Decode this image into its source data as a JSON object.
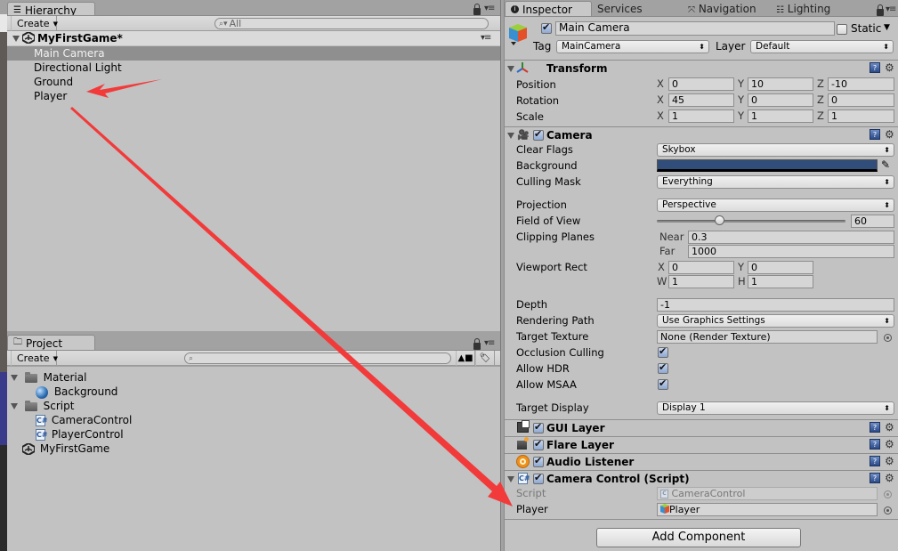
{
  "hierarchy": {
    "tab_label": "Hierarchy",
    "create_label": "Create",
    "search_placeholder": "All",
    "scene_name": "MyFirstGame*",
    "items": [
      {
        "label": "Main Camera",
        "selected": true
      },
      {
        "label": "Directional Light",
        "selected": false
      },
      {
        "label": "Ground",
        "selected": false
      },
      {
        "label": "Player",
        "selected": false
      }
    ]
  },
  "project": {
    "tab_label": "Project",
    "create_label": "Create",
    "search_placeholder": "",
    "tree": [
      {
        "label": "Material",
        "type": "folder",
        "expanded": true
      },
      {
        "label": "Background",
        "type": "material"
      },
      {
        "label": "Script",
        "type": "folder",
        "expanded": true
      },
      {
        "label": "CameraControl",
        "type": "script"
      },
      {
        "label": "PlayerControl",
        "type": "script"
      },
      {
        "label": "MyFirstGame",
        "type": "scene"
      }
    ]
  },
  "inspector": {
    "tabs": [
      "Inspector",
      "Services",
      "Navigation",
      "Lighting"
    ],
    "active_tab": "Inspector",
    "object_name": "Main Camera",
    "object_active": true,
    "static_label": "Static",
    "static_checked": false,
    "tag_label": "Tag",
    "tag_value": "MainCamera",
    "layer_label": "Layer",
    "layer_value": "Default",
    "transform": {
      "title": "Transform",
      "rows": [
        {
          "label": "Position",
          "x": "0",
          "y": "10",
          "z": "-10"
        },
        {
          "label": "Rotation",
          "x": "45",
          "y": "0",
          "z": "0"
        },
        {
          "label": "Scale",
          "x": "1",
          "y": "1",
          "z": "1"
        }
      ]
    },
    "camera": {
      "title": "Camera",
      "enabled": true,
      "clear_flags_label": "Clear Flags",
      "clear_flags": "Skybox",
      "background_label": "Background",
      "background_color": "#314d79",
      "culling_mask_label": "Culling Mask",
      "culling_mask": "Everything",
      "projection_label": "Projection",
      "projection": "Perspective",
      "fov_label": "Field of View",
      "fov": "60",
      "fov_fraction": 0.33,
      "clipping_label": "Clipping Planes",
      "near_label": "Near",
      "near": "0.3",
      "far_label": "Far",
      "far": "1000",
      "viewport_label": "Viewport Rect",
      "viewport": {
        "x": "0",
        "y": "0",
        "w": "1",
        "h": "1"
      },
      "depth_label": "Depth",
      "depth": "-1",
      "rendering_path_label": "Rendering Path",
      "rendering_path": "Use Graphics Settings",
      "target_texture_label": "Target Texture",
      "target_texture": "None (Render Texture)",
      "occlusion_label": "Occlusion Culling",
      "occlusion": true,
      "hdr_label": "Allow HDR",
      "hdr": true,
      "msaa_label": "Allow MSAA",
      "msaa": true,
      "target_display_label": "Target Display",
      "target_display": "Display 1"
    },
    "components": [
      {
        "title": "GUI Layer",
        "enabled": true
      },
      {
        "title": "Flare Layer",
        "enabled": true
      },
      {
        "title": "Audio Listener",
        "enabled": true
      }
    ],
    "script_component": {
      "title": "Camera Control (Script)",
      "enabled": true,
      "script_label": "Script",
      "script_value": "CameraControl",
      "player_label": "Player",
      "player_value": "Player"
    },
    "add_component_label": "Add Component"
  },
  "annotations": {
    "arrow_color": "#f23a3a"
  }
}
